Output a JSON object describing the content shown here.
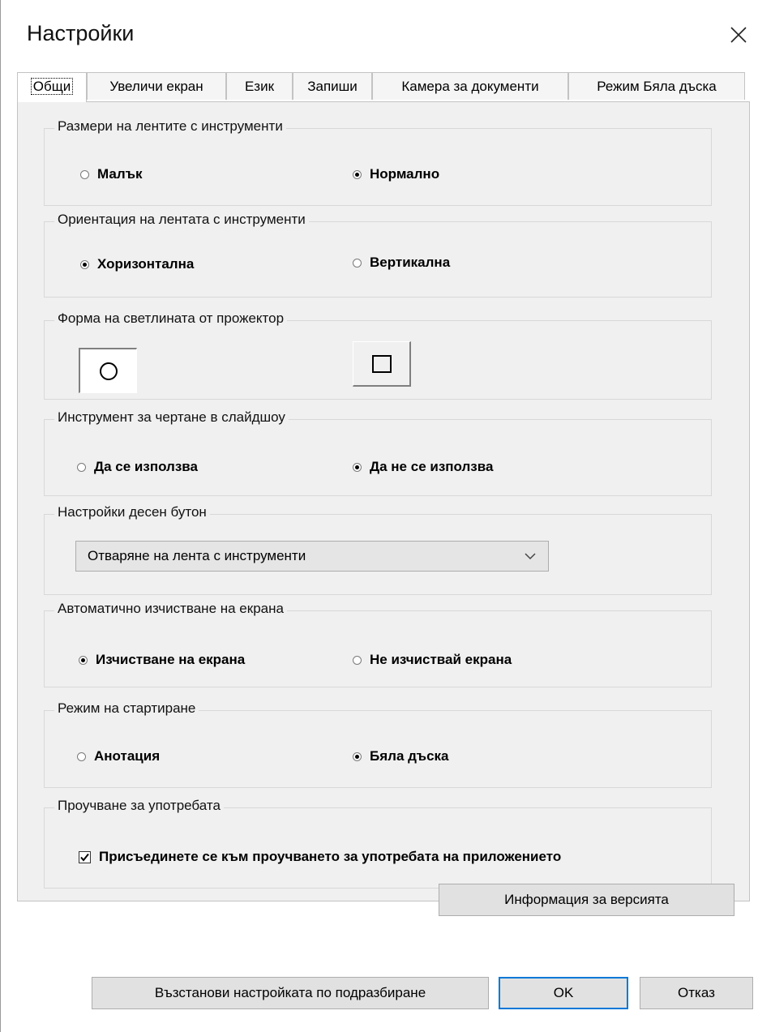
{
  "dialog": {
    "title": "Настройки"
  },
  "tabs": [
    {
      "label": "Общи",
      "active": true
    },
    {
      "label": "Увеличи екран"
    },
    {
      "label": "Език"
    },
    {
      "label": "Запиши"
    },
    {
      "label": "Камера за документи"
    },
    {
      "label": "Режим Бяла дъска"
    }
  ],
  "groups": {
    "toolbar_size": {
      "label": "Размери на лентите с инструменти",
      "options": [
        {
          "label": "Малък",
          "checked": false
        },
        {
          "label": "Нормално",
          "checked": true
        }
      ]
    },
    "toolbar_orientation": {
      "label": "Ориентация на лентата с инструменти",
      "options": [
        {
          "label": "Хоризонтална",
          "checked": true
        },
        {
          "label": "Вертикална",
          "checked": false
        }
      ]
    },
    "spotlight_shape": {
      "label": "Форма на светлината от прожектор",
      "options": [
        {
          "icon": "circle-icon",
          "pressed": true
        },
        {
          "icon": "square-icon",
          "pressed": false
        }
      ]
    },
    "slideshow_drawing": {
      "label": "Инструмент за чертане в слайдшоу",
      "options": [
        {
          "label": "Да се използва",
          "checked": false
        },
        {
          "label": "Да не се използва",
          "checked": true
        }
      ]
    },
    "right_button": {
      "label": "Настройки десен бутон",
      "selected": "Отваряне на лента с инструменти"
    },
    "auto_clear": {
      "label": "Автоматично изчистване на екрана",
      "options": [
        {
          "label": "Изчистване на екрана",
          "checked": true
        },
        {
          "label": "Не изчиствай екрана",
          "checked": false
        }
      ]
    },
    "startup_mode": {
      "label": "Режим на стартиране",
      "options": [
        {
          "label": "Анотация",
          "checked": false
        },
        {
          "label": "Бяла дъска",
          "checked": true
        }
      ]
    },
    "usage_study": {
      "label": "Проучване за употребата",
      "checkbox_label": "Присъединете се към проучването за употребата на приложението",
      "checked": true
    }
  },
  "version_button": "Информация за версията",
  "footer": {
    "restore_defaults": "Възстанови настройката по подразбиране",
    "ok": "OK",
    "cancel": "Отказ"
  }
}
